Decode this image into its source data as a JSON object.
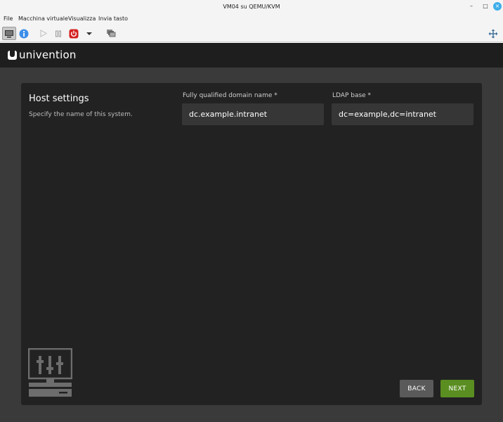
{
  "window": {
    "title": "VM04 su QEMU/KVM",
    "minimize_glyph": "–",
    "maximize_glyph": "□",
    "close_glyph": "×"
  },
  "menu": {
    "items": [
      {
        "label": "File"
      },
      {
        "label": "Macchina virtuale"
      },
      {
        "label": "Visualizza"
      },
      {
        "label": "Invia tasto"
      }
    ]
  },
  "toolbar": {
    "icons": [
      "console-icon",
      "info-icon",
      "play-icon",
      "pause-icon",
      "power-icon",
      "chevron-down-icon",
      "snapshot-icon",
      "resize-icon"
    ],
    "colors": {
      "info": "#3d8ee9",
      "power": "#d42020"
    }
  },
  "app": {
    "brand": "univention"
  },
  "page": {
    "title": "Host settings",
    "subtitle": "Specify the name of this system.",
    "fqdn": {
      "label": "Fully qualified domain name *",
      "value": "dc.example.intranet"
    },
    "ldap": {
      "label": "LDAP base *",
      "value": "dc=example,dc=intranet"
    },
    "illustration": "server-settings-icon"
  },
  "buttons": {
    "back": "BACK",
    "next": "NEXT"
  },
  "colors": {
    "next_button": "#5a8e21",
    "back_button": "#5a5a5a",
    "panel": "#222222",
    "background": "#3a3a3a"
  }
}
